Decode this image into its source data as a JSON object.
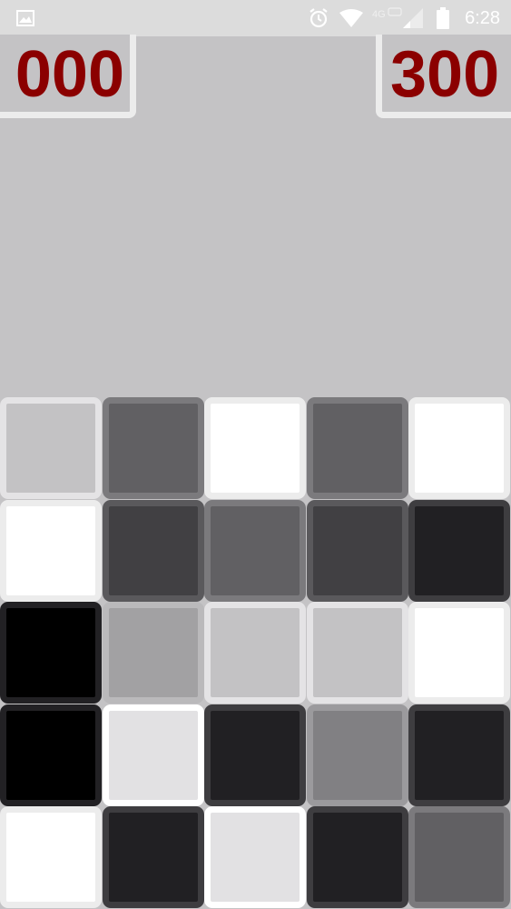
{
  "status_bar": {
    "time": "6:28",
    "icons": [
      "image-notification-icon",
      "alarm-icon",
      "wifi-icon",
      "cell-signal-icon",
      "battery-icon"
    ]
  },
  "scores": {
    "left": "000",
    "right": "300",
    "color": "#8b0000"
  },
  "board": {
    "rows": 5,
    "cols": 5,
    "tiles": [
      [
        {
          "fill": "#c3c2c4",
          "border": "#e4e3e5"
        },
        {
          "fill": "#616063",
          "border": "#7b7a7d"
        },
        {
          "fill": "#ffffff",
          "border": "#ececec"
        },
        {
          "fill": "#616063",
          "border": "#7b7a7d"
        },
        {
          "fill": "#ffffff",
          "border": "#ececec"
        }
      ],
      [
        {
          "fill": "#ffffff",
          "border": "#ececec"
        },
        {
          "fill": "#414043",
          "border": "#5a595c"
        },
        {
          "fill": "#616063",
          "border": "#7b7a7d"
        },
        {
          "fill": "#414043",
          "border": "#5a595c"
        },
        {
          "fill": "#212023",
          "border": "#3e3d40"
        }
      ],
      [
        {
          "fill": "#000000",
          "border": "#222124"
        },
        {
          "fill": "#a2a1a3",
          "border": "#bab9bb"
        },
        {
          "fill": "#c3c2c4",
          "border": "#e4e3e5"
        },
        {
          "fill": "#c3c2c4",
          "border": "#e4e3e5"
        },
        {
          "fill": "#ffffff",
          "border": "#ececec"
        }
      ],
      [
        {
          "fill": "#000000",
          "border": "#222124"
        },
        {
          "fill": "#e2e1e3",
          "border": "#ffffff"
        },
        {
          "fill": "#212023",
          "border": "#3e3d40"
        },
        {
          "fill": "#818083",
          "border": "#9b9a9d"
        },
        {
          "fill": "#212023",
          "border": "#3e3d40"
        }
      ],
      [
        {
          "fill": "#ffffff",
          "border": "#ececec"
        },
        {
          "fill": "#212023",
          "border": "#3e3d40"
        },
        {
          "fill": "#e2e1e3",
          "border": "#ffffff"
        },
        {
          "fill": "#212023",
          "border": "#3e3d40"
        },
        {
          "fill": "#616063",
          "border": "#7b7a7d"
        }
      ]
    ]
  }
}
